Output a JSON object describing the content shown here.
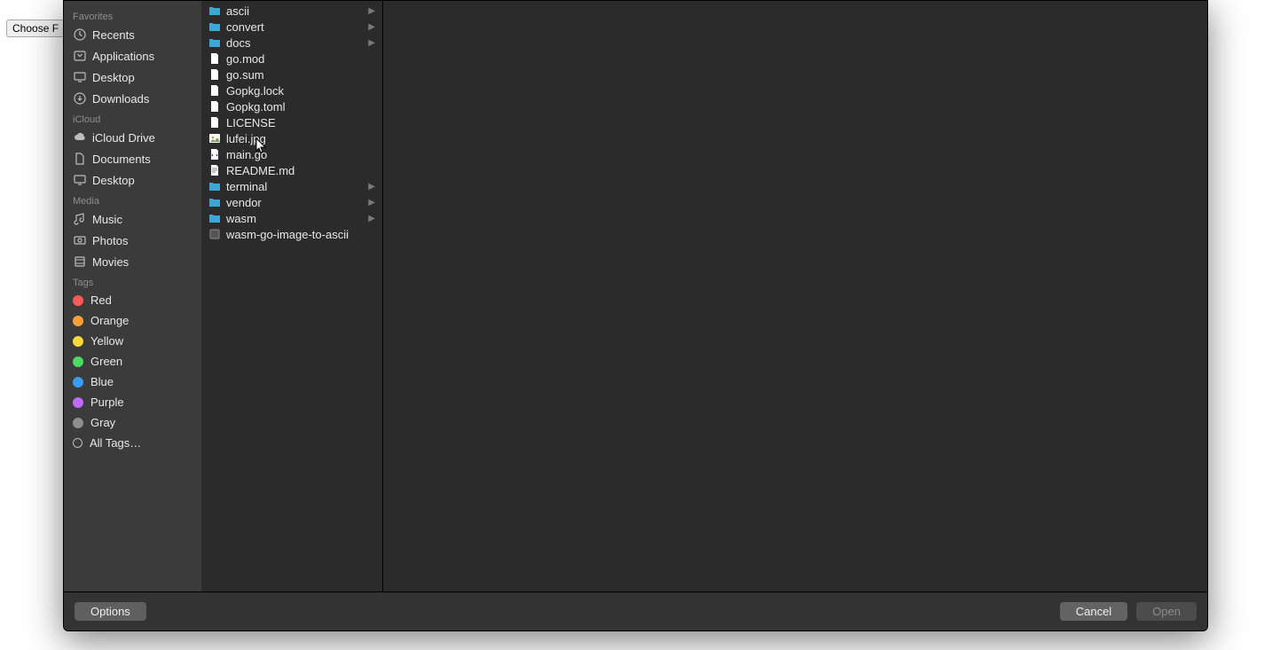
{
  "page": {
    "choose_file_label": "Choose F"
  },
  "sidebar": {
    "sections": {
      "favorites": {
        "header": "Favorites",
        "items": [
          "Recents",
          "Applications",
          "Desktop",
          "Downloads"
        ]
      },
      "icloud": {
        "header": "iCloud",
        "items": [
          "iCloud Drive",
          "Documents",
          "Desktop"
        ]
      },
      "media": {
        "header": "Media",
        "items": [
          "Music",
          "Photos",
          "Movies"
        ]
      },
      "tags": {
        "header": "Tags",
        "items": [
          {
            "label": "Red",
            "color": "#ff5b56"
          },
          {
            "label": "Orange",
            "color": "#ff9f3a"
          },
          {
            "label": "Yellow",
            "color": "#ffd93a"
          },
          {
            "label": "Green",
            "color": "#4cd964"
          },
          {
            "label": "Blue",
            "color": "#3b9bff"
          },
          {
            "label": "Purple",
            "color": "#c06bff"
          },
          {
            "label": "Gray",
            "color": "#8e8e8e"
          }
        ],
        "all_tags_label": "All Tags…"
      }
    }
  },
  "files": [
    {
      "name": "ascii",
      "type": "folder",
      "expandable": true
    },
    {
      "name": "convert",
      "type": "folder",
      "expandable": true
    },
    {
      "name": "docs",
      "type": "folder",
      "expandable": true
    },
    {
      "name": "go.mod",
      "type": "file",
      "expandable": false
    },
    {
      "name": "go.sum",
      "type": "file",
      "expandable": false
    },
    {
      "name": "Gopkg.lock",
      "type": "file",
      "expandable": false
    },
    {
      "name": "Gopkg.toml",
      "type": "file",
      "expandable": false
    },
    {
      "name": "LICENSE",
      "type": "file",
      "expandable": false
    },
    {
      "name": "lufei.jpg",
      "type": "image",
      "expandable": false
    },
    {
      "name": "main.go",
      "type": "code",
      "expandable": false
    },
    {
      "name": "README.md",
      "type": "text",
      "expandable": false
    },
    {
      "name": "terminal",
      "type": "folder",
      "expandable": true
    },
    {
      "name": "vendor",
      "type": "folder",
      "expandable": true
    },
    {
      "name": "wasm",
      "type": "folder",
      "expandable": true
    },
    {
      "name": "wasm-go-image-to-ascii",
      "type": "exec",
      "expandable": false
    }
  ],
  "footer": {
    "options_label": "Options",
    "cancel_label": "Cancel",
    "open_label": "Open"
  }
}
